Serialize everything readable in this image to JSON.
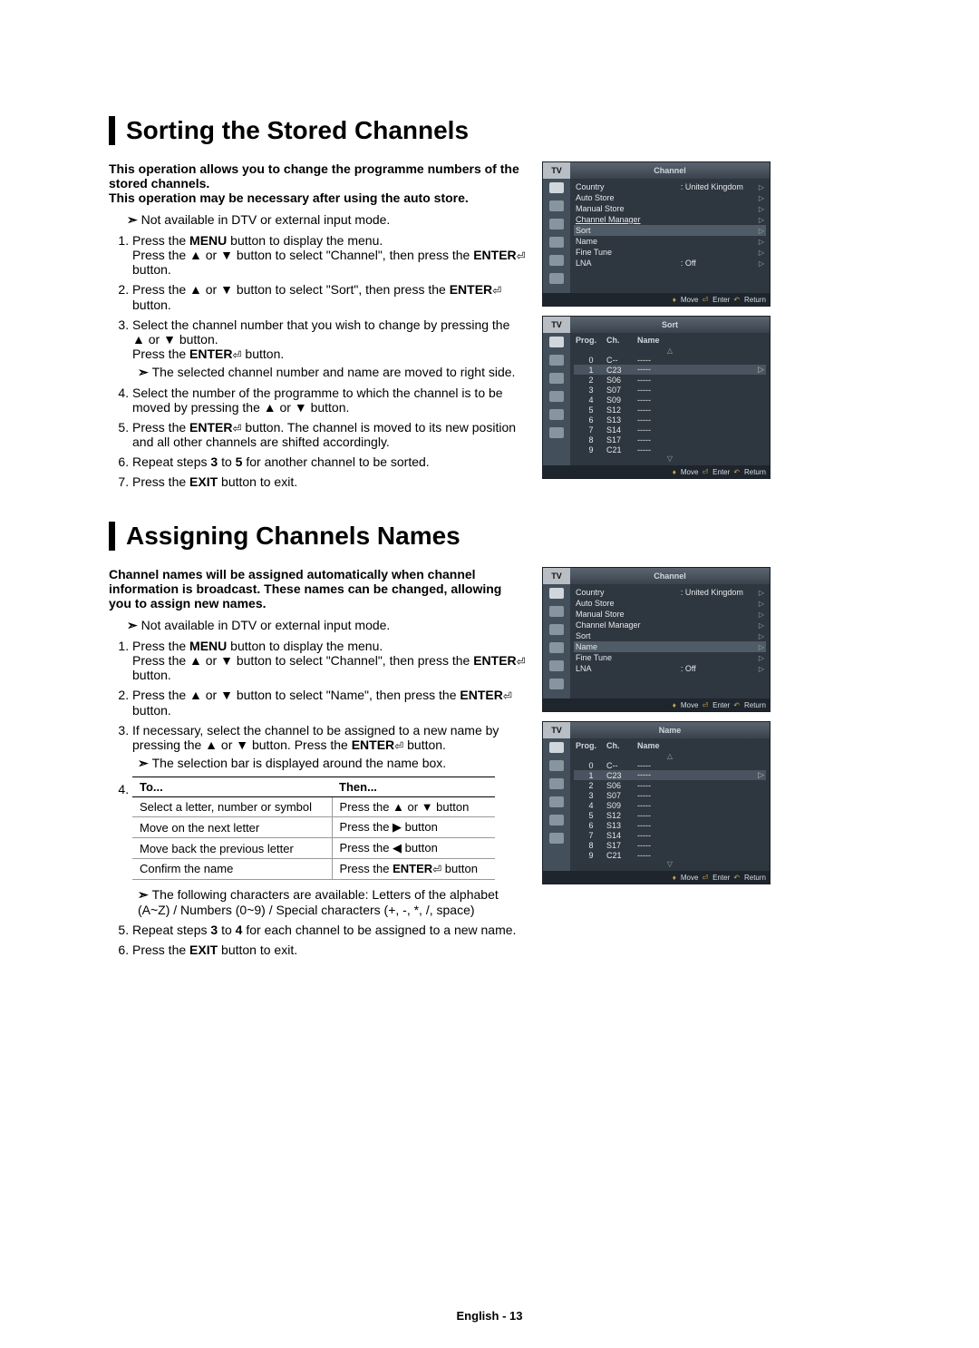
{
  "page_footer": "English - 13",
  "section1": {
    "title": "Sorting the Stored Channels",
    "intro1": "This operation allows you to change the programme numbers of the stored channels.",
    "intro2": "This operation may be necessary after using the auto store.",
    "note": "Not available in DTV or external input mode.",
    "step1a": "Press the ",
    "step1a_bold": "MENU",
    "step1a_end": " button to display the menu.",
    "step1b": "Press the ▲ or ▼ button to select \"Channel\", then press the ",
    "step1b_bold": "ENTER",
    "step1b_end": " button.",
    "step2a": "Press the ▲ or ▼ button to select \"Sort\", then press the ",
    "step2a_bold": "ENTER",
    "step2a_end": " button.",
    "step3a": "Select the channel number that you wish to change by pressing the ▲ or ▼ button.",
    "step3b": "Press the ",
    "step3b_bold": "ENTER",
    "step3b_end": " button.",
    "step3_sub": "The selected channel number and name are moved to right side.",
    "step4": "Select the number of the programme to which the channel is to be moved by pressing the ▲ or ▼ button.",
    "step5a": "Press the ",
    "step5a_bold": "ENTER",
    "step5a_end": " button. The channel is moved to its new position and all other channels are shifted accordingly.",
    "step6a": "Repeat steps ",
    "step6b": "3",
    "step6c": " to ",
    "step6d": "5",
    "step6e": " for another channel to be sorted.",
    "step7a": "Press the ",
    "step7a_bold": "EXIT",
    "step7a_end": " button to exit."
  },
  "section2": {
    "title": "Assigning Channels Names",
    "intro": "Channel names will be assigned automatically when channel information is broadcast. These names can be changed, allowing you to assign new names.",
    "note": "Not available in DTV or external input mode.",
    "step1a": "Press the ",
    "step1a_bold": "MENU",
    "step1a_end": " button to display the menu.",
    "step1b": "Press the ▲ or ▼ button to select \"Channel\", then press the ",
    "step1b_bold": "ENTER",
    "step1b_end": " button.",
    "step2a": "Press the ▲ or ▼ button to select \"Name\", then press the ",
    "step2a_bold": "ENTER",
    "step2a_end": " button.",
    "step3a": "If necessary, select the channel to be assigned to a new name by pressing the ▲ or ▼ button. Press the ",
    "step3a_bold": "ENTER",
    "step3a_end": " button.",
    "step3_sub": "The selection bar is displayed around the name box.",
    "table": {
      "h1": "To...",
      "h2": "Then...",
      "rows": [
        {
          "to": "Select a letter, number or symbol",
          "then": "Press the ▲ or ▼ button"
        },
        {
          "to": "Move on the next letter",
          "then": "Press the ▶ button"
        },
        {
          "to": "Move back the previous letter",
          "then": "Press the ◀ button"
        },
        {
          "to": "Confirm the name",
          "then_pre": "Press the ",
          "then_bold": "ENTER",
          "then_post": " button"
        }
      ]
    },
    "step4_sub": "The following characters are available: Letters of the alphabet (A~Z) / Numbers (0~9) / Special characters (+, -, *, /, space)",
    "step5a": "Repeat steps ",
    "step5b": "3",
    "step5c": " to ",
    "step5d": "4",
    "step5e": " for each channel to be assigned to a new name.",
    "step6a": "Press the ",
    "step6a_bold": "EXIT",
    "step6a_end": " button to exit."
  },
  "osd": {
    "tv_label": "TV",
    "channel_title": "Channel",
    "sort_title": "Sort",
    "name_title": "Name",
    "menu": {
      "country_label": "Country",
      "country_value": ": United Kingdom",
      "auto_store": "Auto Store",
      "manual_store": "Manual Store",
      "channel_manager": "Channel Manager",
      "sort": "Sort",
      "name": "Name",
      "fine_tune": "Fine Tune",
      "lna_label": "LNA",
      "lna_value": ": Off"
    },
    "footer": {
      "move": "Move",
      "enter": "Enter",
      "return": "Return"
    },
    "list_header": {
      "prog": "Prog.",
      "ch": "Ch.",
      "name": "Name"
    },
    "rows": [
      {
        "prog": "0",
        "ch": "C--",
        "name": "-----"
      },
      {
        "prog": "1",
        "ch": "C23",
        "name": "-----"
      },
      {
        "prog": "2",
        "ch": "S06",
        "name": "-----"
      },
      {
        "prog": "3",
        "ch": "S07",
        "name": "-----"
      },
      {
        "prog": "4",
        "ch": "S09",
        "name": "-----"
      },
      {
        "prog": "5",
        "ch": "S12",
        "name": "-----"
      },
      {
        "prog": "6",
        "ch": "S13",
        "name": "-----"
      },
      {
        "prog": "7",
        "ch": "S14",
        "name": "-----"
      },
      {
        "prog": "8",
        "ch": "S17",
        "name": "-----"
      },
      {
        "prog": "9",
        "ch": "C21",
        "name": "-----"
      }
    ]
  }
}
